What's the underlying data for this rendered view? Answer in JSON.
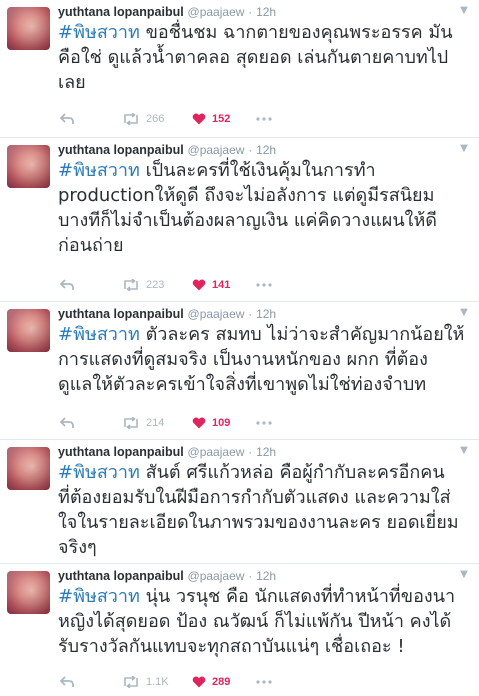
{
  "tweets": [
    {
      "name": "yuthtana lopanpaibul",
      "handle": "@paajaew",
      "dot": "·",
      "time": "12h",
      "hashtag": "#พิษสวาท",
      "lines": [
        " ขอชื่นชม ฉากตายของคุณพระอรรค มัน",
        "คือใช่ ดูแล้วน้ำตาคลอ สุดยอด เล่นกันตายคาบทไป",
        "เลย"
      ],
      "retweets": "266",
      "likes": "152"
    },
    {
      "name": "yuthtana lopanpaibul",
      "handle": "@paajaew",
      "dot": "·",
      "time": "12h",
      "hashtag": "#พิษสวาท",
      "lines": [
        " เป็นละครที่ใช้เงินคุ้มในการทำ",
        "productionให้ดูดี ถึงจะไม่อลังการ แต่ดูมีรสนิยม",
        "บางทีก็ไม่จำเป็นต้องผลาญเงิน แค่คิดวางแผนให้ดี",
        "ก่อนถ่าย"
      ],
      "retweets": "223",
      "likes": "141"
    },
    {
      "name": "yuthtana lopanpaibul",
      "handle": "@paajaew",
      "dot": "·",
      "time": "12h",
      "hashtag": "#พิษสวาท",
      "lines": [
        " ตัวละคร สมทบ ไม่ว่าจะสำคัญมากน้อยให้",
        "การแสดงที่ดูสมจริง เป็นงานหนักของ ผกก ที่ต้อง",
        "ดูแลให้ตัวละครเข้าใจสิ่งที่เขาพูดไม่ใช่ท่องจำบท"
      ],
      "retweets": "214",
      "likes": "109"
    },
    {
      "name": "yuthtana lopanpaibul",
      "handle": "@paajaew",
      "dot": "·",
      "time": "12h",
      "hashtag": "#พิษสวาท",
      "lines": [
        " สันต์ ศรีแก้วหล่อ คือผู้กำกับละครอีกคน",
        "ที่ต้องยอมรับในฝีมือการกำกับตัวแสดง และความใส่",
        "ใจในรายละเอียดในภาพรวมของงานละคร ยอดเยี่ยม",
        "จริงๆ"
      ],
      "retweets": "",
      "likes": ""
    },
    {
      "name": "yuthtana lopanpaibul",
      "handle": "@paajaew",
      "dot": "·",
      "time": "12h",
      "hashtag": "#พิษสวาท",
      "lines": [
        " นุ่น วรนุช คือ นักแสดงที่ทำหน้าที่ของนา",
        "หญิงได้สุดยอด ป้อง ณวัฒน์ ก็ไม่แพ้กัน ปีหน้า คงได้",
        "รับรางวัลกันแทบจะทุกสถาบันแน่ๆ เชื่อเถอะ !"
      ],
      "retweets": "1.1K",
      "likes": "289"
    }
  ],
  "colors": {
    "hashtag": "#2b7bb9",
    "like": "#e0245e",
    "meta": "#8899a6",
    "icons": "#aab8c2"
  },
  "icons": [
    "reply-icon",
    "retweet-icon",
    "heart-icon",
    "more-icon",
    "chevron-down-icon"
  ]
}
